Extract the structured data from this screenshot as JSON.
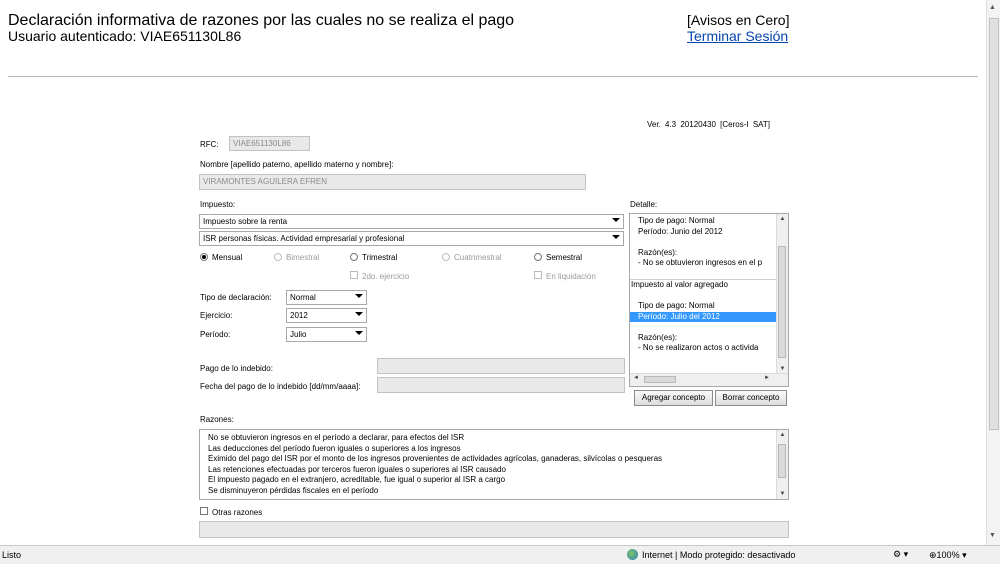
{
  "header": {
    "title": "Declaración informativa de razones por las cuales no se realiza el pago",
    "user_line": "Usuario autenticado: VIAE651130L86",
    "avisos": "[Avisos en Cero]",
    "logout": "Terminar Sesión"
  },
  "version": "Ver. 4.3   20120430   [Ceros-I SAT]",
  "form": {
    "rfc_label": "RFC:",
    "rfc_value": "VIAE651130L86",
    "nombre_label": "Nombre [apellido paterno, apellido materno y nombre]:",
    "nombre_value": "VIRAMONTES AGUILERA EFREN",
    "impuesto_label": "Impuesto:",
    "impuesto_value": "Impuesto sobre la renta",
    "subimpuesto_value": "ISR personas físicas. Actividad empresarial y profesional",
    "periodicidad": {
      "mensual": "Mensual",
      "bimestral": "Bimestral",
      "trimestral": "Trimestral",
      "cuatrimestral": "Cuatrimestral",
      "semestral": "Semestral"
    },
    "segundo_ejercicio": "2do. ejercicio",
    "en_liquidacion": "En liquidación",
    "tipo_decl_label": "Tipo de declaración:",
    "tipo_decl_value": "Normal",
    "ejercicio_label": "Ejercicio:",
    "ejercicio_value": "2012",
    "periodo_label": "Período:",
    "periodo_value": "Julio",
    "pago_indebido_label": "Pago de lo indebido:",
    "fecha_pago_label": "Fecha del pago de lo indebido [dd/mm/aaaa]:",
    "razones_label": "Razones:",
    "razones": [
      "No se obtuvieron ingresos en el período a declarar, para efectos del ISR",
      "Las deducciones del período fueron iguales o superiores a los ingresos",
      "Eximido del pago del ISR por el monto de los ingresos provenientes de actividades agrícolas, ganaderas, silvícolas o pesqueras",
      "Las retenciones efectuadas por terceros fueron iguales o superiores al ISR causado",
      "El impuesto pagado en el extranjero, acreditable, fue igual o superior al ISR a cargo",
      "Se disminuyeron pérdidas fiscales en el período"
    ],
    "otras_razones": "Otras razones"
  },
  "detalle": {
    "label": "Detalle:",
    "lines": [
      "Tipo de pago: Normal",
      "Período: Junio del 2012",
      "",
      "Razón(es):",
      "  -     No se obtuvieron ingresos en el p",
      "",
      "Impuesto al valor agregado",
      "",
      "Tipo de pago: Normal",
      "Período: Julio del 2012",
      "",
      "Razón(es):",
      "  -     No se realizaron actos o activida"
    ],
    "selected_index": 9,
    "agregar": "Agregar concepto",
    "borrar": "Borrar concepto"
  },
  "statusbar": {
    "left": "Listo",
    "zone": "Internet | Modo protegido: desactivado",
    "zoom": "100%"
  }
}
